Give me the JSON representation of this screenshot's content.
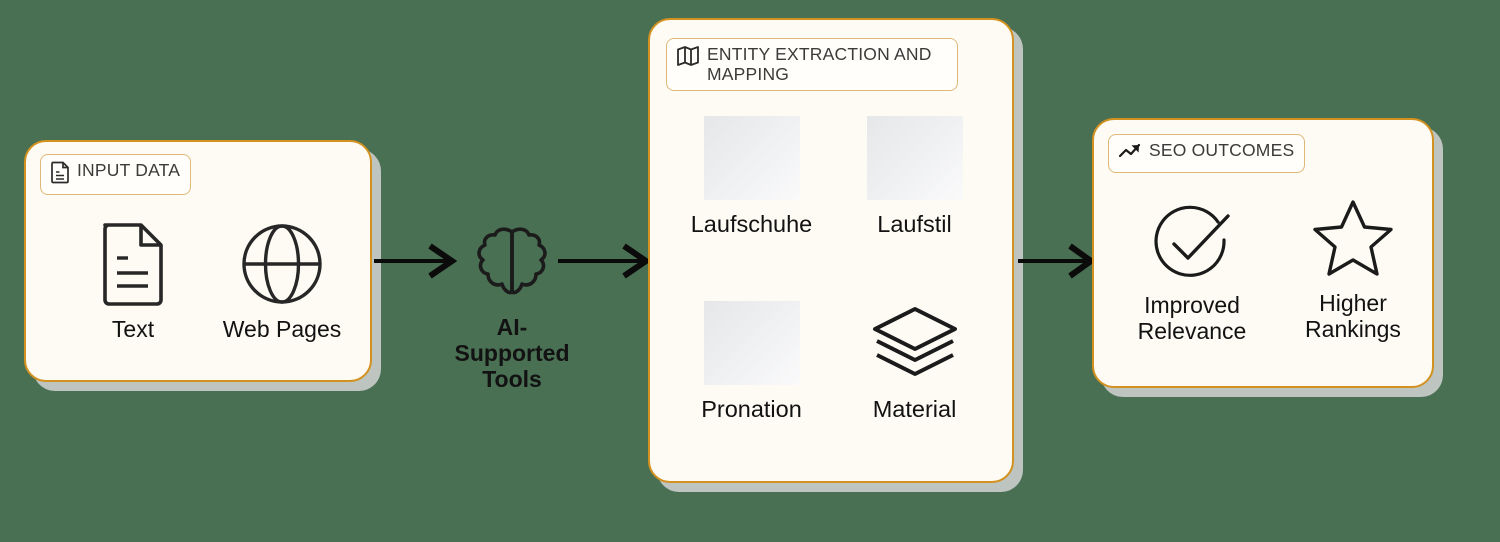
{
  "background_color": "#4a7054",
  "accent_color": "#d3911f",
  "panel_fill": "#fdfbf3",
  "badge_border_color": "#e0b878",
  "text_color": "#121212",
  "diagram": {
    "title_flow": "Input Data to AI-Supported Tools to Entity Extraction and Mapping to SEO Outcomes",
    "panels": [
      {
        "id": "input-data",
        "badge_label": "INPUT DATA",
        "badge_icon": "document-text-icon",
        "items": [
          {
            "label": "Text",
            "icon": "document-icon"
          },
          {
            "label": "Web Pages",
            "icon": "globe-icon"
          }
        ]
      },
      {
        "id": "entity-extraction",
        "badge_label": "ENTITY EXTRACTION AND\nMAPPING",
        "badge_icon": "map-icon",
        "items": [
          {
            "label": "Laufschuhe",
            "icon": "image-placeholder"
          },
          {
            "label": "Laufstil",
            "icon": "image-placeholder"
          },
          {
            "label": "Pronation",
            "icon": "image-placeholder"
          },
          {
            "label": "Material",
            "icon": "layers-icon"
          }
        ]
      },
      {
        "id": "seo-outcomes",
        "badge_label": "SEO OUTCOMES",
        "badge_icon": "trending-up-icon",
        "items": [
          {
            "label": "Improved\nRelevance",
            "icon": "circle-check-icon"
          },
          {
            "label": "Higher\nRankings",
            "icon": "star-icon"
          }
        ]
      }
    ],
    "middle_node": {
      "label": "AI-\nSupported\nTools",
      "icon": "brain-icon"
    },
    "arrows": [
      {
        "from": "input-data",
        "to": "middle_node",
        "icon": "arrow-right-icon"
      },
      {
        "from": "middle_node",
        "to": "entity-extraction",
        "icon": "arrow-right-icon"
      },
      {
        "from": "entity-extraction",
        "to": "seo-outcomes",
        "icon": "arrow-right-icon"
      }
    ]
  }
}
